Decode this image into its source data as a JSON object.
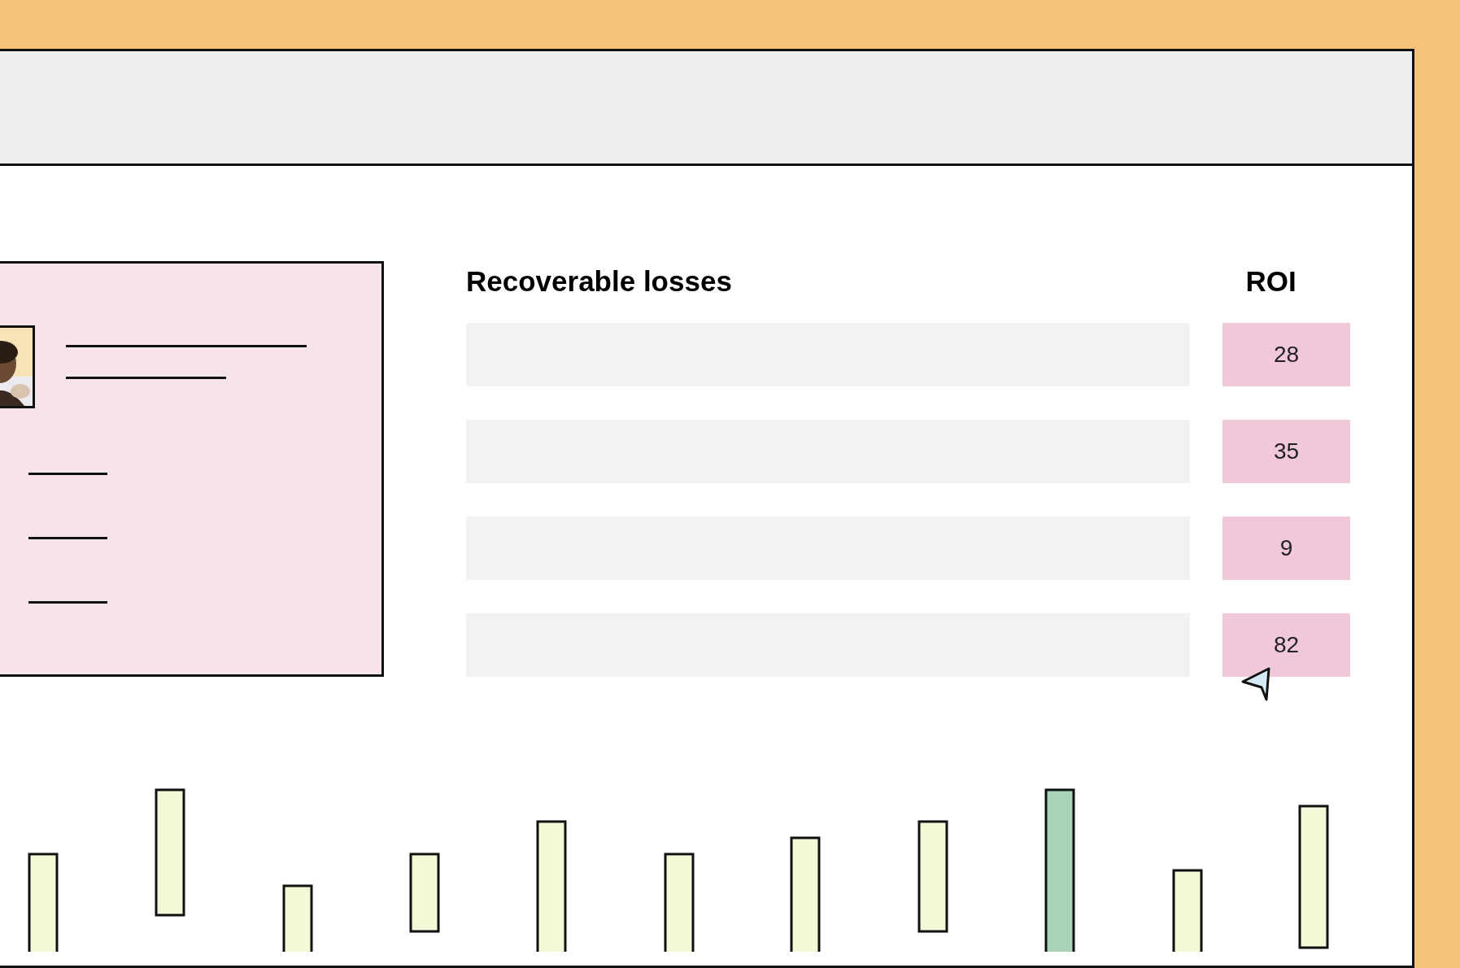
{
  "table": {
    "columns": [
      {
        "label": "Recoverable losses"
      },
      {
        "label": "ROI"
      }
    ],
    "rows": [
      {
        "roi": "28"
      },
      {
        "roi": "35"
      },
      {
        "roi": "9"
      },
      {
        "roi": "82"
      }
    ]
  }
}
